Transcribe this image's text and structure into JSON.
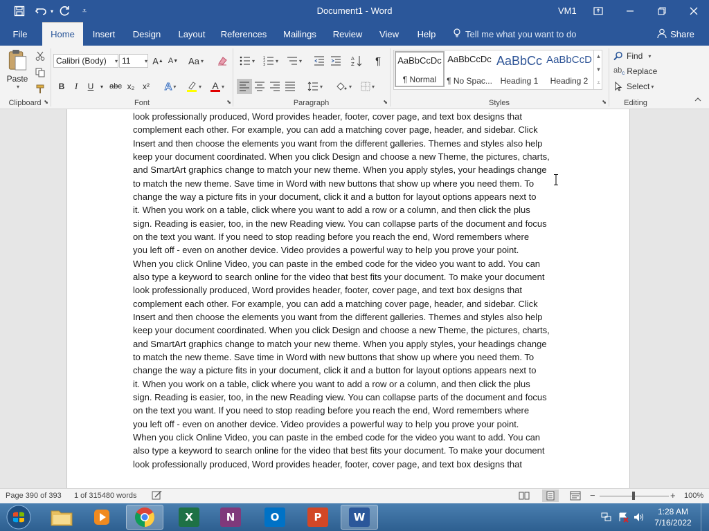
{
  "titlebar": {
    "title": "Document1 - Word",
    "user": "VM1",
    "qat": {
      "save_icon": "save-icon",
      "undo_icon": "undo-icon",
      "redo_icon": "redo-icon",
      "customize_icon": "customize-qat-icon"
    }
  },
  "tabs": [
    {
      "label": "File"
    },
    {
      "label": "Home"
    },
    {
      "label": "Insert"
    },
    {
      "label": "Design"
    },
    {
      "label": "Layout"
    },
    {
      "label": "References"
    },
    {
      "label": "Mailings"
    },
    {
      "label": "Review"
    },
    {
      "label": "View"
    },
    {
      "label": "Help"
    }
  ],
  "tell_me": "Tell me what you want to do",
  "share": "Share",
  "ribbon": {
    "clipboard": {
      "paste": "Paste",
      "label": "Clipboard"
    },
    "font": {
      "name": "Calibri (Body)",
      "size": "11",
      "change_case": "Aa",
      "bold": "B",
      "italic": "I",
      "underline": "U",
      "strike": "abc",
      "subscript": "x₂",
      "superscript": "x²",
      "label": "Font"
    },
    "paragraph": {
      "label": "Paragraph"
    },
    "styles": {
      "items": [
        {
          "sample": "AaBbCcDc",
          "name": "¶ Normal"
        },
        {
          "sample": "AaBbCcDc",
          "name": "¶ No Spac..."
        },
        {
          "sample": "AaBbCc",
          "name": "Heading 1"
        },
        {
          "sample": "AaBbCcD",
          "name": "Heading 2"
        }
      ],
      "label": "Styles"
    },
    "editing": {
      "find": "Find",
      "replace": "Replace",
      "select": "Select",
      "label": "Editing"
    }
  },
  "document": {
    "lines": [
      "look professionally produced, Word provides header, footer, cover page, and text box designs that",
      "complement each other. For example, you can add a matching cover page, header, and sidebar. Click",
      "Insert and then choose the elements you want from the different galleries. Themes and styles also help",
      "keep your document coordinated. When you click Design and choose a new Theme, the pictures, charts,",
      "and SmartArt graphics change to match your new theme. When you apply styles, your headings change",
      "to match the new theme. Save time in Word with new buttons that show up where you need them. To",
      "change the way a picture fits in your document, click it and a button for layout options appears next to",
      "it. When you work on a table, click where you want to add a row or a column, and then click the plus",
      "sign. Reading is easier, too, in the new Reading view. You can collapse parts of the document and focus",
      "on the text you want. If you need to stop reading before you reach the end, Word remembers where",
      "you left off - even on another device. Video provides a powerful way to help you prove your point.",
      "When you click Online Video, you can paste in the embed code for the video you want to add. You can",
      "also type a keyword to search online for the video that best fits your document. To make your document",
      "look professionally produced, Word provides header, footer, cover page, and text box designs that",
      "complement each other. For example, you can add a matching cover page, header, and sidebar. Click",
      "Insert and then choose the elements you want from the different galleries. Themes and styles also help",
      "keep your document coordinated. When you click Design and choose a new Theme, the pictures, charts,",
      "and SmartArt graphics change to match your new theme. When you apply styles, your headings change",
      "to match the new theme. Save time in Word with new buttons that show up where you need them. To",
      "change the way a picture fits in your document, click it and a button for layout options appears next to",
      "it. When you work on a table, click where you want to add a row or a column, and then click the plus",
      "sign. Reading is easier, too, in the new Reading view. You can collapse parts of the document and focus",
      "on the text you want. If you need to stop reading before you reach the end, Word remembers where",
      "you left off - even on another device. Video provides a powerful way to help you prove your point.",
      "When you click Online Video, you can paste in the embed code for the video you want to add. You can",
      "also type a keyword to search online for the video that best fits your document. To make your document",
      "look professionally produced, Word provides header, footer, cover page, and text box designs that"
    ]
  },
  "status": {
    "page": "Page 390 of 393",
    "words": "1 of 315480 words",
    "zoom": "100%"
  },
  "taskbar": {
    "apps": [
      {
        "name": "File Explorer",
        "icon": "folder-icon"
      },
      {
        "name": "Media Player",
        "icon": "media-player-icon"
      },
      {
        "name": "Chrome",
        "icon": "chrome-icon"
      },
      {
        "name": "Excel",
        "icon": "excel-icon",
        "letter": "X"
      },
      {
        "name": "OneNote",
        "icon": "onenote-icon",
        "letter": "N"
      },
      {
        "name": "Outlook",
        "icon": "outlook-icon",
        "letter": "O"
      },
      {
        "name": "PowerPoint",
        "icon": "powerpoint-icon",
        "letter": "P"
      },
      {
        "name": "Word",
        "icon": "word-icon",
        "letter": "W"
      }
    ],
    "time": "1:28 AM",
    "date": "7/16/2022"
  },
  "colors": {
    "word_blue": "#2b579a",
    "excel": "#1e7145",
    "onenote": "#80397b",
    "outlook": "#0072c6",
    "powerpoint": "#d24726"
  }
}
